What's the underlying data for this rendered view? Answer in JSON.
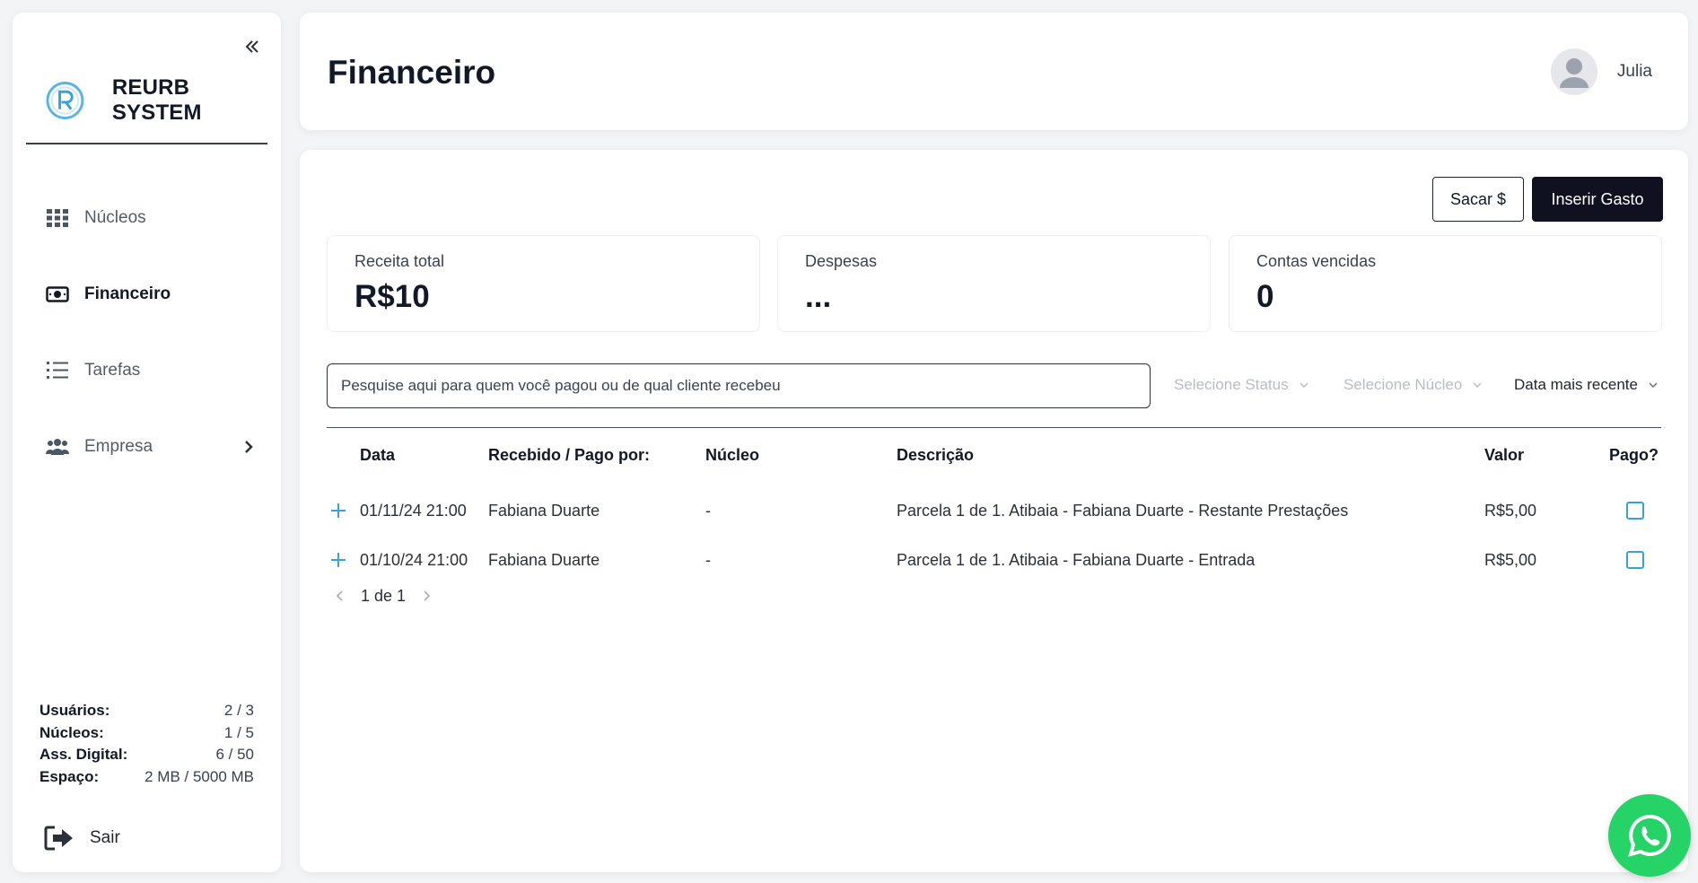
{
  "sidebar": {
    "brand": "REURB SYSTEM",
    "items": [
      {
        "label": "Núcleos",
        "icon": "grid-icon"
      },
      {
        "label": "Financeiro",
        "icon": "money-icon",
        "active": true
      },
      {
        "label": "Tarefas",
        "icon": "list-icon"
      },
      {
        "label": "Empresa",
        "icon": "users-icon",
        "has_submenu": true
      }
    ],
    "usage": [
      {
        "label": "Usuários:",
        "value": "2 / 3"
      },
      {
        "label": "Núcleos:",
        "value": "1 / 5"
      },
      {
        "label": "Ass. Digital:",
        "value": "6 / 50"
      },
      {
        "label": "Espaço:",
        "value": "2 MB / 5000 MB"
      }
    ],
    "logout_label": "Sair"
  },
  "header": {
    "title": "Financeiro",
    "user_name": "Julia"
  },
  "actions": {
    "withdraw_label": "Sacar $",
    "insert_expense_label": "Inserir Gasto"
  },
  "stats": [
    {
      "label": "Receita total",
      "value": "R$10"
    },
    {
      "label": "Despesas",
      "value": "..."
    },
    {
      "label": "Contas vencidas",
      "value": "0"
    }
  ],
  "filters": {
    "search_placeholder": "Pesquise aqui para quem você pagou ou de qual cliente recebeu",
    "status": "Selecione Status",
    "nucleo": "Selecione Núcleo",
    "sort": "Data mais recente"
  },
  "table": {
    "columns": [
      "Data",
      "Recebido / Pago por:",
      "Núcleo",
      "Descrição",
      "Valor",
      "Pago?"
    ],
    "rows": [
      {
        "date": "01/11/24 21:00",
        "payer": "Fabiana Duarte",
        "nucleo": "-",
        "description": "Parcela 1 de 1. Atibaia - Fabiana Duarte - Restante Prestações",
        "value": "R$5,00",
        "paid": false
      },
      {
        "date": "01/10/24 21:00",
        "payer": "Fabiana Duarte",
        "nucleo": "-",
        "description": "Parcela 1 de 1. Atibaia - Fabiana Duarte - Entrada",
        "value": "R$5,00",
        "paid": false
      }
    ]
  },
  "pagination": {
    "text": "1 de 1"
  },
  "colors": {
    "accent": "#3aa0d8",
    "dark_button": "#0f1120",
    "whatsapp": "#25d366"
  }
}
